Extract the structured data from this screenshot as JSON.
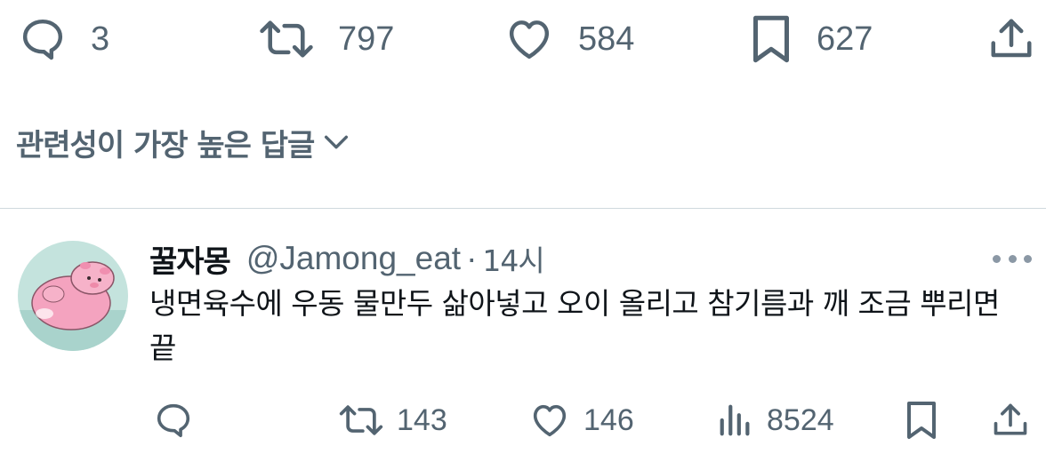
{
  "tweet_actions": {
    "reply_count": "3",
    "retweet_count": "797",
    "like_count": "584",
    "bookmark_count": "627"
  },
  "sort": {
    "label": "관련성이 가장 높은 답글"
  },
  "reply": {
    "display_name": "꿀자몽",
    "handle": "@Jamong_eat",
    "separator": "·",
    "time": "14시",
    "text": "냉면육수에 우동 물만두 삶아넣고 오이 올리고 참기름과 깨 조금 뿌리면 끝",
    "retweet_count": "143",
    "like_count": "146",
    "view_count": "8524"
  },
  "colors": {
    "secondary_text": "#536471",
    "primary_text": "#0f1419",
    "divider": "#cfd9de",
    "avatar_bg": "#c4e3dd",
    "avatar_pig": "#f4a3bf"
  },
  "icons": [
    "reply-icon",
    "retweet-icon",
    "like-icon",
    "bookmark-icon",
    "share-icon",
    "chevron-down-icon",
    "views-icon",
    "more-icon"
  ]
}
